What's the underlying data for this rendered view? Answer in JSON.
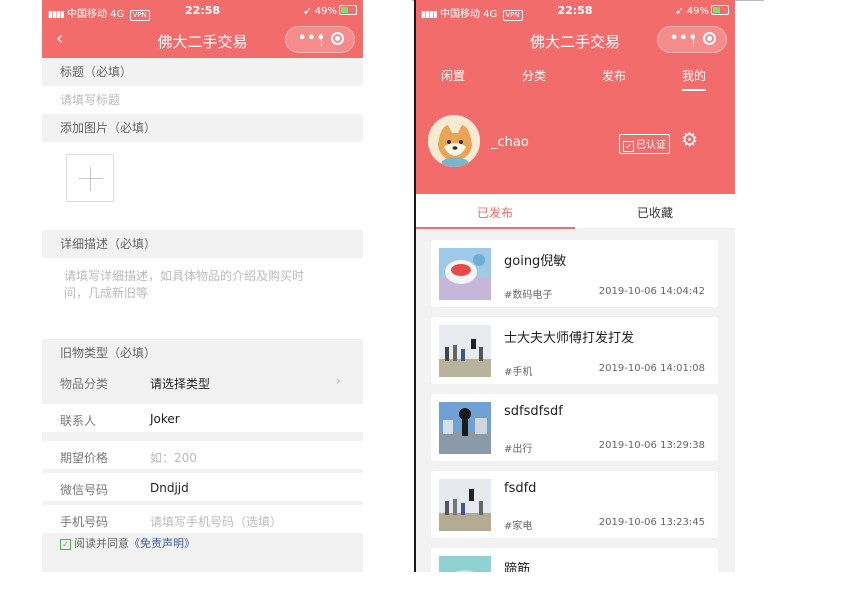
{
  "left": {
    "status": {
      "carrier": "中国移动",
      "network": "4G",
      "vpn": "VPN",
      "time": "22:58",
      "battery": "49%"
    },
    "nav_title": "佛大二手交易",
    "sections": {
      "title_header": "标题（必填）",
      "title_placeholder": "请填写标题",
      "image_header": "添加图片（必填）",
      "desc_header": "详细描述（必填）",
      "desc_placeholder": "请填写详细描述，如具体物品的介绍及购买时间，几成新旧等",
      "type_header": "旧物类型（必填）"
    },
    "fields": {
      "category_label": "物品分类",
      "category_value": "请选择类型",
      "contact_label": "联系人",
      "contact_value": "Joker",
      "price_label": "期望价格",
      "price_placeholder": "如：200",
      "wechat_label": "微信号码",
      "wechat_value": "Dndjjd",
      "phone_label": "手机号码",
      "phone_placeholder": "请填写手机号码（选填）"
    },
    "agree_text": "阅读并同意",
    "agree_link": "《免责声明》"
  },
  "right": {
    "status": {
      "carrier": "中国移动",
      "network": "4G",
      "vpn": "VPN",
      "time": "22:58",
      "battery": "49%"
    },
    "nav_title": "佛大二手交易",
    "top_tabs": [
      "闲置",
      "分类",
      "发布",
      "我的"
    ],
    "username": "_chao",
    "verified": "已认证",
    "sub_tabs": [
      "已发布",
      "已收藏"
    ],
    "items": [
      {
        "title": "going倪敏",
        "tag": "#数码电子",
        "date": "2019-10-06 14:04:42"
      },
      {
        "title": "士大夫大师傅打发打发",
        "tag": "#手机",
        "date": "2019-10-06 14:01:08"
      },
      {
        "title": "sdfsdfsdf",
        "tag": "#出行",
        "date": "2019-10-06 13:29:38"
      },
      {
        "title": "fsdfd",
        "tag": "#家电",
        "date": "2019-10-06 13:23:45"
      },
      {
        "title": "蹄筋",
        "tag": "",
        "date": ""
      }
    ]
  },
  "colors": {
    "accent": "#f36c6c",
    "background": "#f2f2f2"
  }
}
